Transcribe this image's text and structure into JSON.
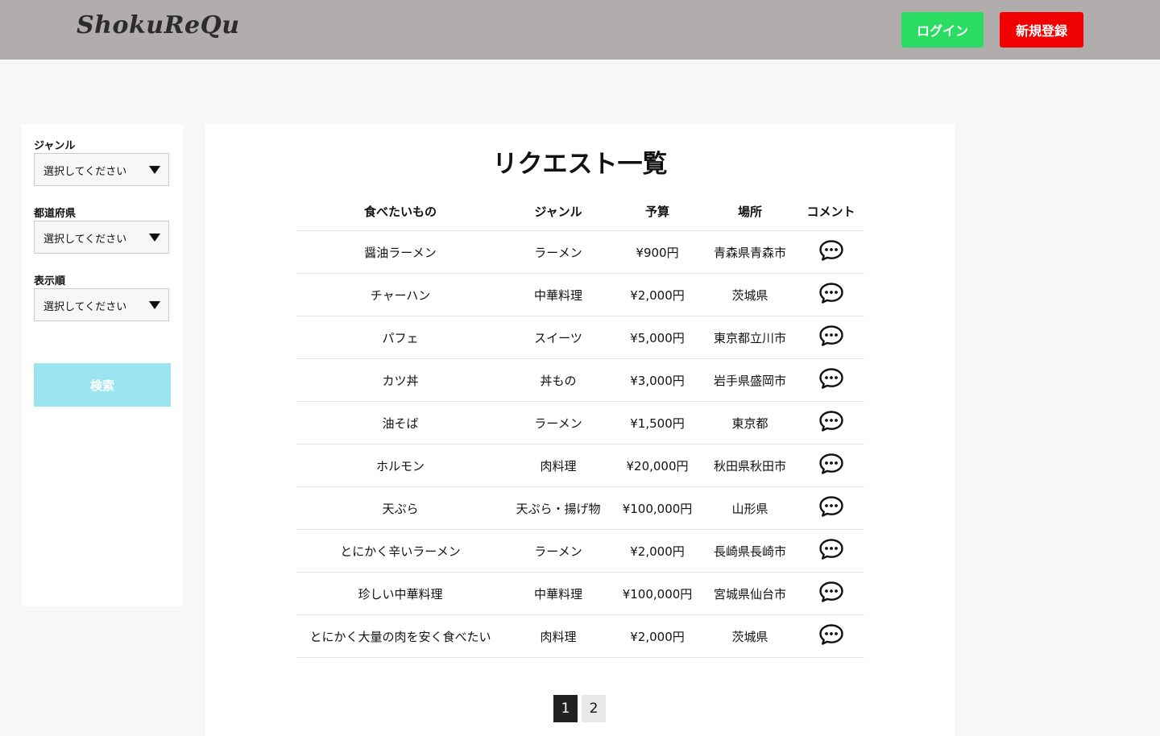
{
  "header": {
    "logo": "ShokuReQu",
    "login_label": "ログイン",
    "signup_label": "新規登録",
    "colors": {
      "bar": "#b1adac",
      "login": "#2bdc62",
      "signup": "#f10000"
    }
  },
  "sidebar": {
    "filters": [
      {
        "label": "ジャンル",
        "value": "選択してください"
      },
      {
        "label": "都道府県",
        "value": "選択してください"
      },
      {
        "label": "表示順",
        "value": "選択してください"
      }
    ],
    "search_label": "検索"
  },
  "main": {
    "title": "リクエスト一覧",
    "columns": [
      "食べたいもの",
      "ジャンル",
      "予算",
      "場所",
      "コメント"
    ],
    "rows": [
      {
        "food": "醤油ラーメン",
        "genre": "ラーメン",
        "budget": "¥900円",
        "place": "青森県青森市",
        "icon": "comment-icon"
      },
      {
        "food": "チャーハン",
        "genre": "中華料理",
        "budget": "¥2,000円",
        "place": "茨城県",
        "icon": "comment-icon"
      },
      {
        "food": "パフェ",
        "genre": "スイーツ",
        "budget": "¥5,000円",
        "place": "東京都立川市",
        "icon": "comment-icon"
      },
      {
        "food": "カツ丼",
        "genre": "丼もの",
        "budget": "¥3,000円",
        "place": "岩手県盛岡市",
        "icon": "comment-icon"
      },
      {
        "food": "油そば",
        "genre": "ラーメン",
        "budget": "¥1,500円",
        "place": "東京都",
        "icon": "comment-icon"
      },
      {
        "food": "ホルモン",
        "genre": "肉料理",
        "budget": "¥20,000円",
        "place": "秋田県秋田市",
        "icon": "comment-icon"
      },
      {
        "food": "天ぷら",
        "genre": "天ぷら・揚げ物",
        "budget": "¥100,000円",
        "place": "山形県",
        "icon": "comment-icon"
      },
      {
        "food": "とにかく辛いラーメン",
        "genre": "ラーメン",
        "budget": "¥2,000円",
        "place": "長崎県長崎市",
        "icon": "comment-icon"
      },
      {
        "food": "珍しい中華料理",
        "genre": "中華料理",
        "budget": "¥100,000円",
        "place": "宮城県仙台市",
        "icon": "comment-icon"
      },
      {
        "food": "とにかく大量の肉を安く食べたい",
        "genre": "肉料理",
        "budget": "¥2,000円",
        "place": "茨城県",
        "icon": "comment-icon"
      }
    ],
    "pages": [
      "1",
      "2"
    ],
    "current_page": "1"
  }
}
